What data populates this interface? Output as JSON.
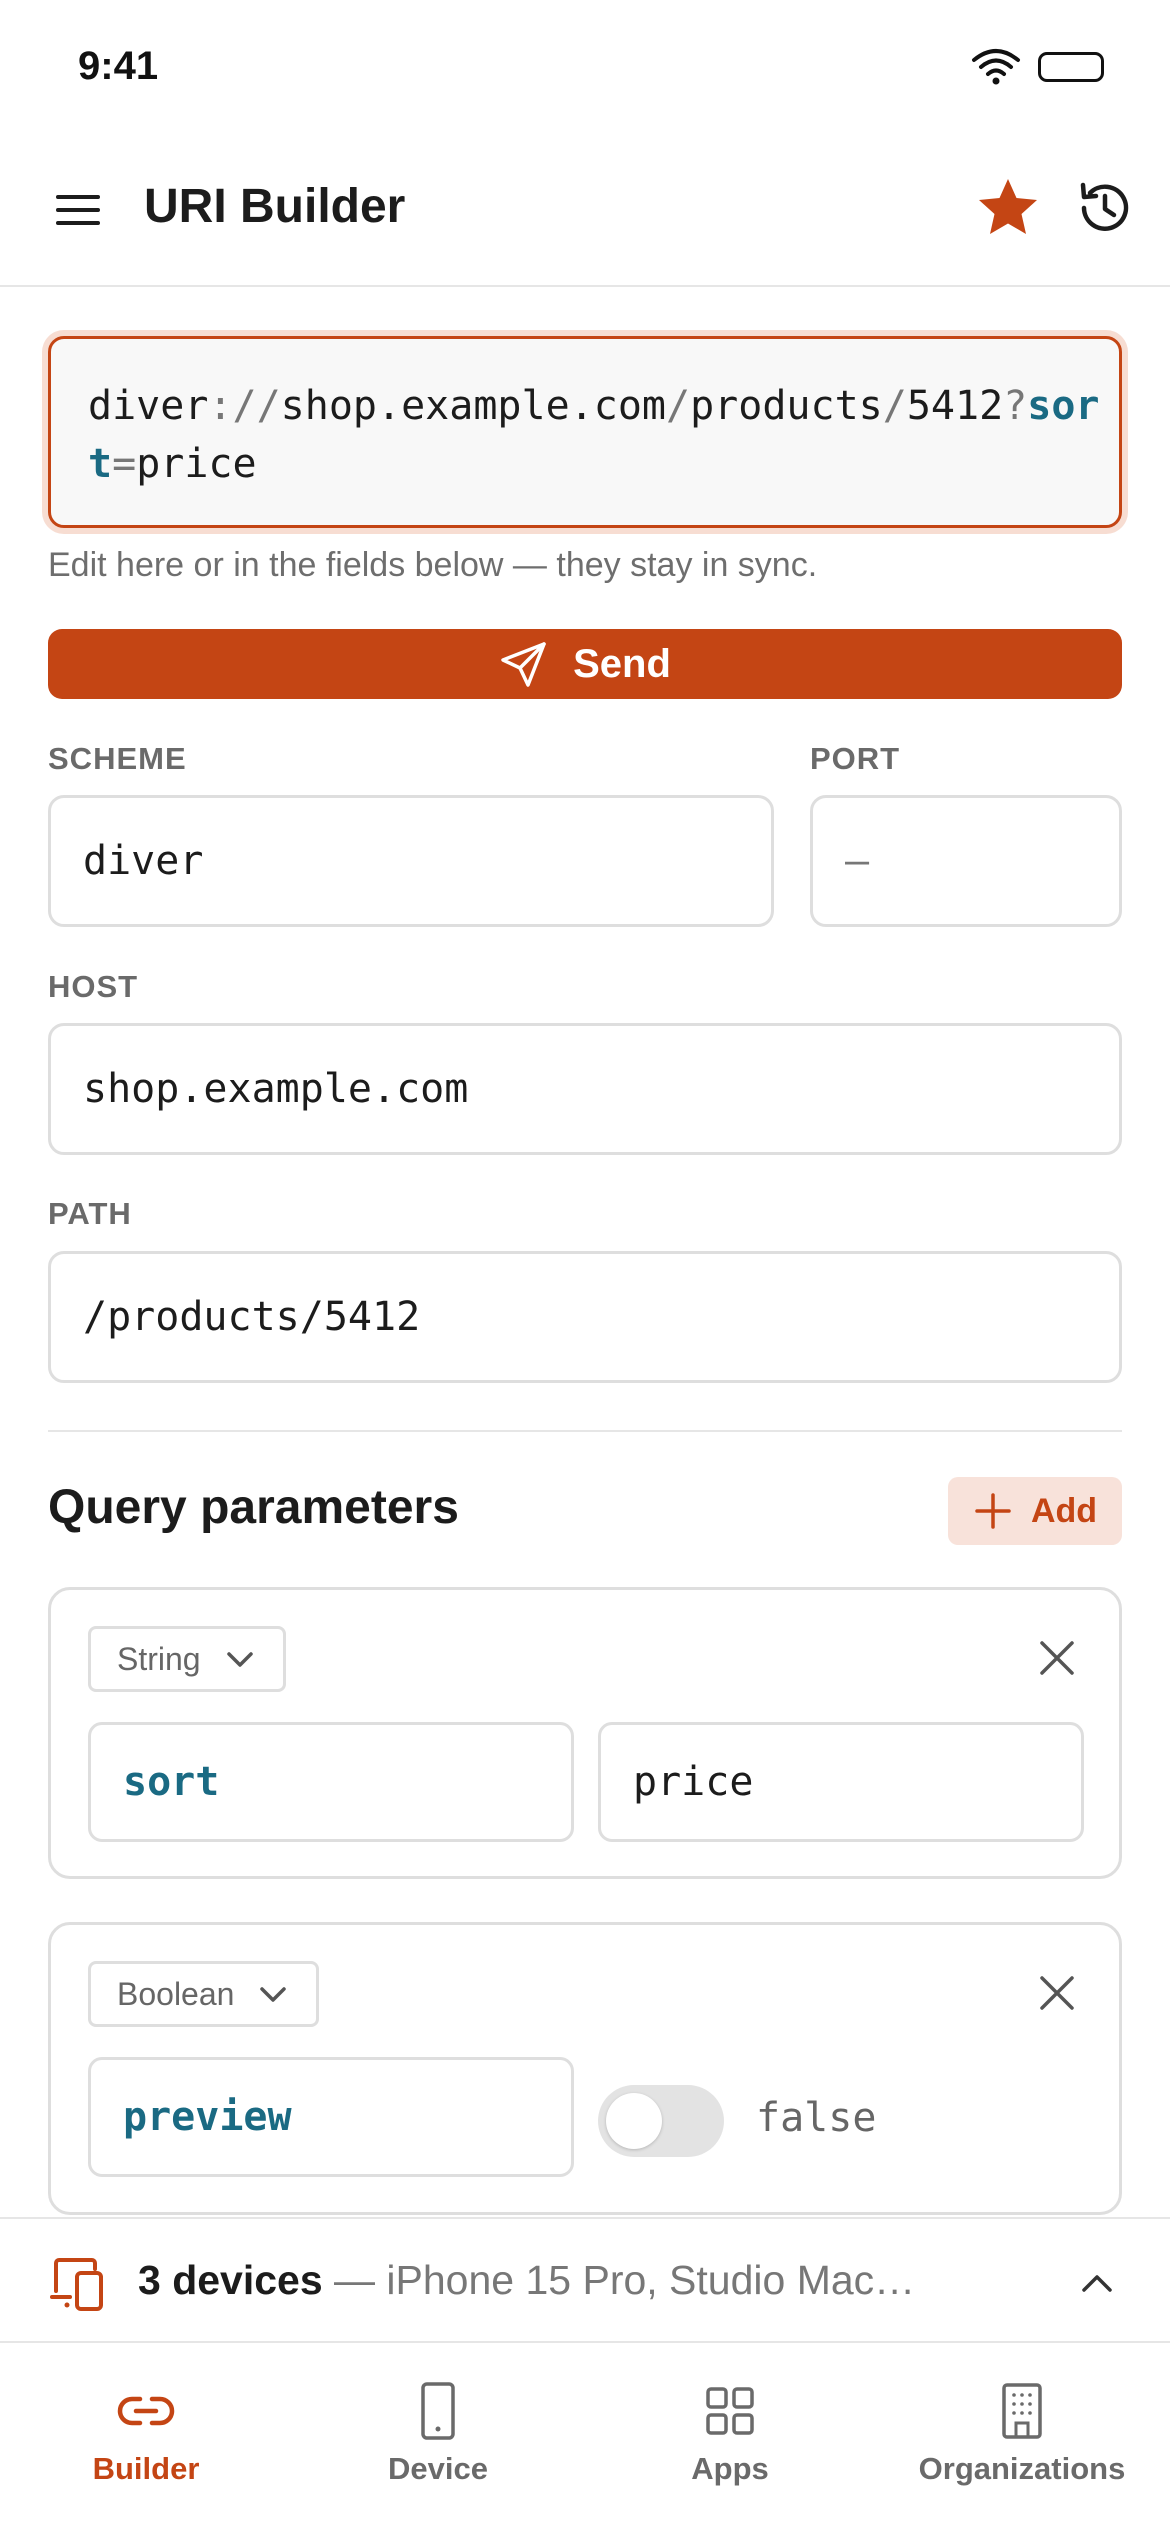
{
  "status_bar": {
    "time": "9:41"
  },
  "app_bar": {
    "title": "URI Builder"
  },
  "uri": {
    "scheme": "diver",
    "sep1": "://",
    "host": "shop.example.com",
    "path_sep1": "/",
    "path_seg1": "products",
    "path_sep2": "/",
    "path_seg2": "5412",
    "query_sep": "?",
    "query_key": "sort",
    "query_eq": "=",
    "query_value": "price",
    "hint": "Edit here or in the fields below — they stay in sync."
  },
  "send_label": "Send",
  "fields": {
    "scheme": {
      "label": "SCHEME",
      "value": "diver"
    },
    "port": {
      "label": "PORT",
      "value": "—"
    },
    "host": {
      "label": "HOST",
      "value": "shop.example.com"
    },
    "path": {
      "label": "PATH",
      "value": "/products/5412"
    }
  },
  "query": {
    "title": "Query parameters",
    "add_label": "Add",
    "params": [
      {
        "type": "String",
        "key": "sort",
        "value": "price"
      },
      {
        "type": "Boolean",
        "key": "preview",
        "value": "false",
        "enabled": false
      }
    ]
  },
  "devices": {
    "count_label": "3 devices",
    "list_label": " — iPhone 15 Pro, Studio Mac…"
  },
  "tabs": [
    {
      "label": "Builder",
      "icon": "link-icon",
      "active": true
    },
    {
      "label": "Device",
      "icon": "phone-icon",
      "active": false
    },
    {
      "label": "Apps",
      "icon": "grid-icon",
      "active": false
    },
    {
      "label": "Organizations",
      "icon": "building-icon",
      "active": false
    }
  ],
  "colors": {
    "accent": "#c44514",
    "key": "#1a6a83",
    "accent_light": "#f8e2da"
  }
}
